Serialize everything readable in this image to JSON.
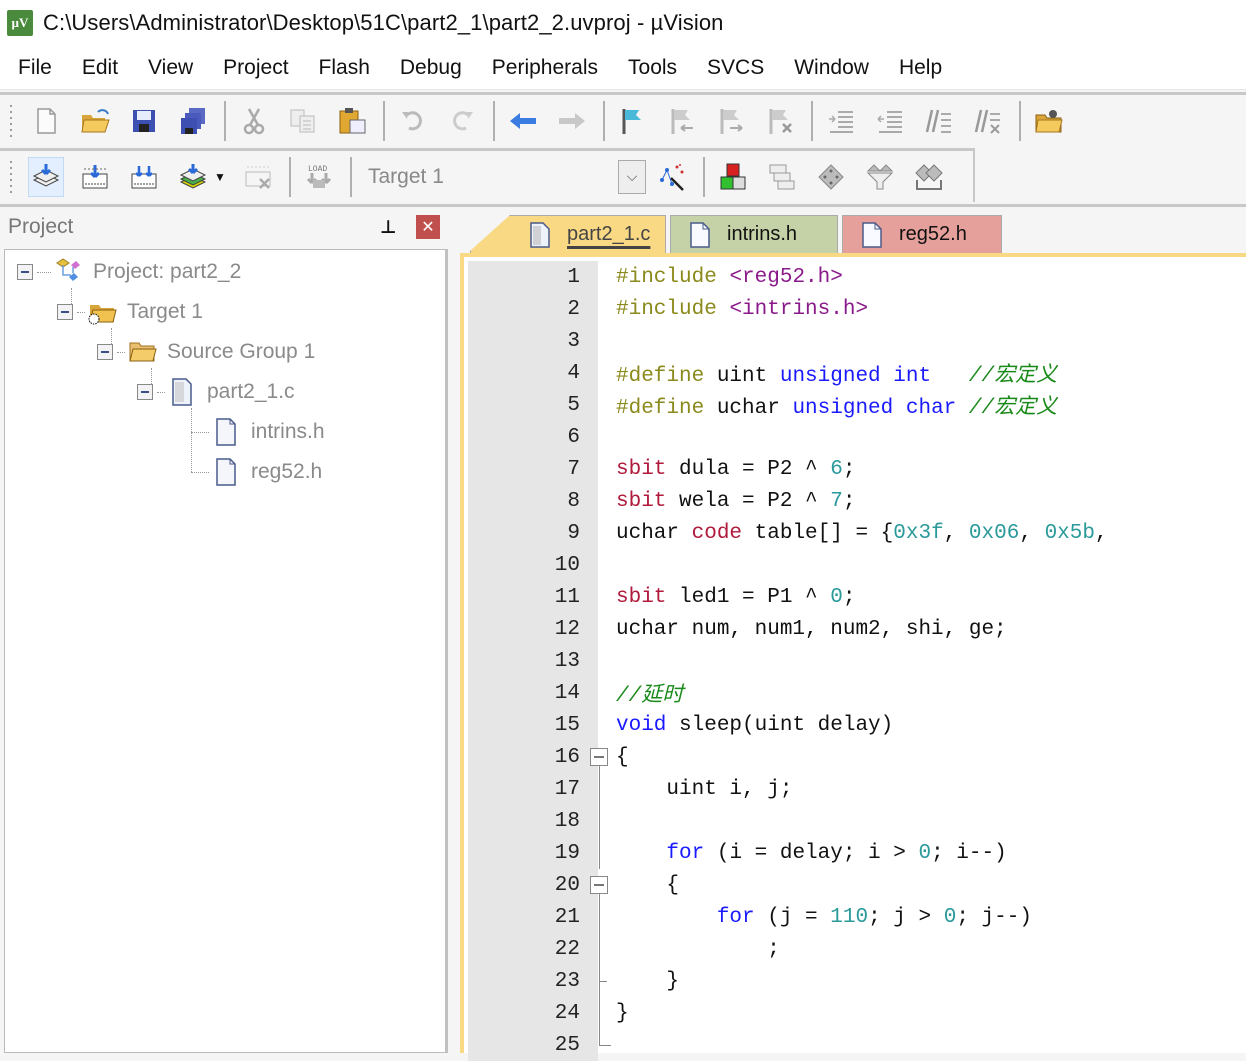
{
  "window": {
    "title": "C:\\Users\\Administrator\\Desktop\\51C\\part2_1\\part2_2.uvproj - µVision",
    "app_icon": "uvision-logo-icon"
  },
  "menu": [
    "File",
    "Edit",
    "View",
    "Project",
    "Flash",
    "Debug",
    "Peripherals",
    "Tools",
    "SVCS",
    "Window",
    "Help"
  ],
  "toolbar1": {
    "buttons": [
      "new-file",
      "open-file",
      "save",
      "save-all",
      "cut",
      "copy",
      "paste",
      "undo",
      "redo",
      "navigate-back",
      "navigate-forward",
      "insert-bookmark",
      "previous-bookmark",
      "next-bookmark",
      "clear-bookmarks",
      "indent",
      "unindent",
      "comment",
      "uncomment",
      "find-in-files"
    ]
  },
  "toolbar2": {
    "buttons": [
      "translate",
      "build",
      "rebuild",
      "batch-build",
      "stop-build",
      "download"
    ],
    "target_select": "Target 1",
    "right_buttons": [
      "target-options",
      "manage-components",
      "file-extensions",
      "select-packs",
      "pack-installer",
      "manage-run-time"
    ]
  },
  "project_panel": {
    "title": "Project",
    "tree": [
      {
        "label": "Project: part2_2",
        "icon": "project-icon",
        "level": 0,
        "expanded": true
      },
      {
        "label": "Target 1",
        "icon": "target-folder-icon",
        "level": 1,
        "expanded": true
      },
      {
        "label": "Source Group 1",
        "icon": "folder-open-icon",
        "level": 2,
        "expanded": true
      },
      {
        "label": "part2_1.c",
        "icon": "c-file-icon",
        "level": 3,
        "expanded": true
      },
      {
        "label": "intrins.h",
        "icon": "header-file-icon",
        "level": 4
      },
      {
        "label": "reg52.h",
        "icon": "header-file-icon",
        "level": 4
      }
    ]
  },
  "editor": {
    "tabs": [
      {
        "label": "part2_1.c",
        "active": true,
        "color": "#fad985"
      },
      {
        "label": "intrins.h",
        "active": false,
        "color": "#c5d1a6"
      },
      {
        "label": "reg52.h",
        "active": false,
        "color": "#e6a09c"
      }
    ],
    "lines": [
      {
        "n": "1",
        "text": "#include <reg52.h>"
      },
      {
        "n": "2",
        "text": "#include <intrins.h>"
      },
      {
        "n": "3",
        "text": ""
      },
      {
        "n": "4",
        "text": "#define uint unsigned int   //宏定义"
      },
      {
        "n": "5",
        "text": "#define uchar unsigned char //宏定义"
      },
      {
        "n": "6",
        "text": ""
      },
      {
        "n": "7",
        "text": "sbit dula = P2 ^ 6;"
      },
      {
        "n": "8",
        "text": "sbit wela = P2 ^ 7;"
      },
      {
        "n": "9",
        "text": "uchar code table[] = {0x3f, 0x06, 0x5b,"
      },
      {
        "n": "10",
        "text": ""
      },
      {
        "n": "11",
        "text": "sbit led1 = P1 ^ 0;"
      },
      {
        "n": "12",
        "text": "uchar num, num1, num2, shi, ge;"
      },
      {
        "n": "13",
        "text": ""
      },
      {
        "n": "14",
        "text": "//延时"
      },
      {
        "n": "15",
        "text": "void sleep(uint delay)"
      },
      {
        "n": "16",
        "text": "{"
      },
      {
        "n": "17",
        "text": "    uint i, j;"
      },
      {
        "n": "18",
        "text": ""
      },
      {
        "n": "19",
        "text": "    for (i = delay; i > 0; i--)"
      },
      {
        "n": "20",
        "text": "    {"
      },
      {
        "n": "21",
        "text": "        for (j = 110; j > 0; j--)"
      },
      {
        "n": "22",
        "text": "            ;"
      },
      {
        "n": "23",
        "text": "    }"
      },
      {
        "n": "24",
        "text": "}"
      },
      {
        "n": "25",
        "text": ""
      }
    ]
  }
}
